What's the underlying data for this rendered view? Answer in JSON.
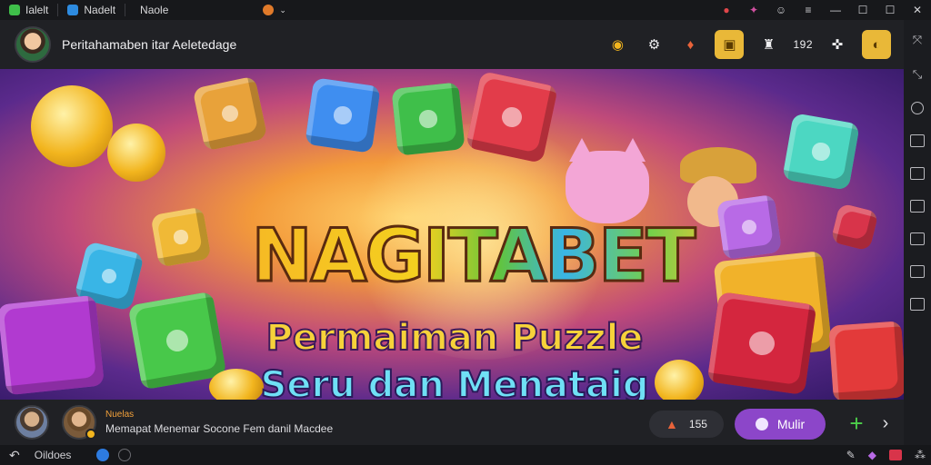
{
  "titlebar": {
    "tabs": [
      {
        "label": "Ialelt",
        "icon": "green-app-icon",
        "color": "#3fbf4a"
      },
      {
        "label": "Nadelt",
        "icon": "blue-app-icon",
        "color": "#2d8be0"
      },
      {
        "label": "Naole",
        "icon": "",
        "color": ""
      }
    ],
    "extension_icon": "orange-extension-icon"
  },
  "header": {
    "title": "Peritahamaben itar Aeletedage",
    "icons": [
      "coin-icon",
      "gear-icon",
      "fire-icon",
      "gift-box-icon",
      "trophy-icon",
      "gamepad-icon"
    ],
    "count_text": "192"
  },
  "banner": {
    "title": "NAGITABET",
    "subtitle_line1": "Permaiman Puzzle",
    "subtitle_line2": "Seru dan Menataig"
  },
  "infobar": {
    "label": "Nuelas",
    "description": "Memapat Menemar Socone Fem danil Macdee",
    "count": "155",
    "action_label": "Mulir"
  },
  "taskbar": {
    "label": "Oildoes"
  },
  "colors": {
    "accent_purple": "#8c46c9",
    "plus_green": "#4ccf4a",
    "gold": "#e9b838"
  }
}
